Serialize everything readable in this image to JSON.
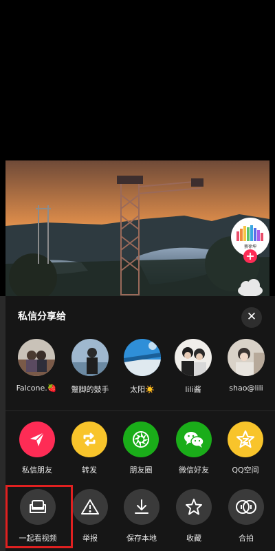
{
  "share_sheet": {
    "title": "私信分享给",
    "close_symbol": "✕"
  },
  "creator": {
    "avatar_text": "蔡徐坤"
  },
  "friends": [
    {
      "name": "Falcone.🍓",
      "icon": "avatar-photo"
    },
    {
      "name": "蹩脚的鼓手",
      "icon": "avatar-photo"
    },
    {
      "name": "太阳☀️",
      "icon": "avatar-photo"
    },
    {
      "name": "lili酱",
      "icon": "avatar-photo"
    },
    {
      "name": "shao@lili",
      "icon": "avatar-photo"
    }
  ],
  "share_apps": [
    {
      "label": "私信朋友",
      "icon": "send-icon",
      "color": "#fe2c55"
    },
    {
      "label": "转发",
      "icon": "repost-icon",
      "color": "#f8c42b"
    },
    {
      "label": "朋友圈",
      "icon": "moments-icon",
      "color": "#1aad19"
    },
    {
      "label": "微信好友",
      "icon": "wechat-icon",
      "color": "#1aad19"
    },
    {
      "label": "QQ空间",
      "icon": "qzone-icon",
      "color": "#f8c42b"
    }
  ],
  "actions": [
    {
      "label": "一起看视频",
      "icon": "sofa-icon"
    },
    {
      "label": "举报",
      "icon": "warning-icon"
    },
    {
      "label": "保存本地",
      "icon": "download-icon"
    },
    {
      "label": "收藏",
      "icon": "star-icon"
    },
    {
      "label": "合拍",
      "icon": "duet-icon"
    }
  ],
  "highlight_color": "#e02020"
}
